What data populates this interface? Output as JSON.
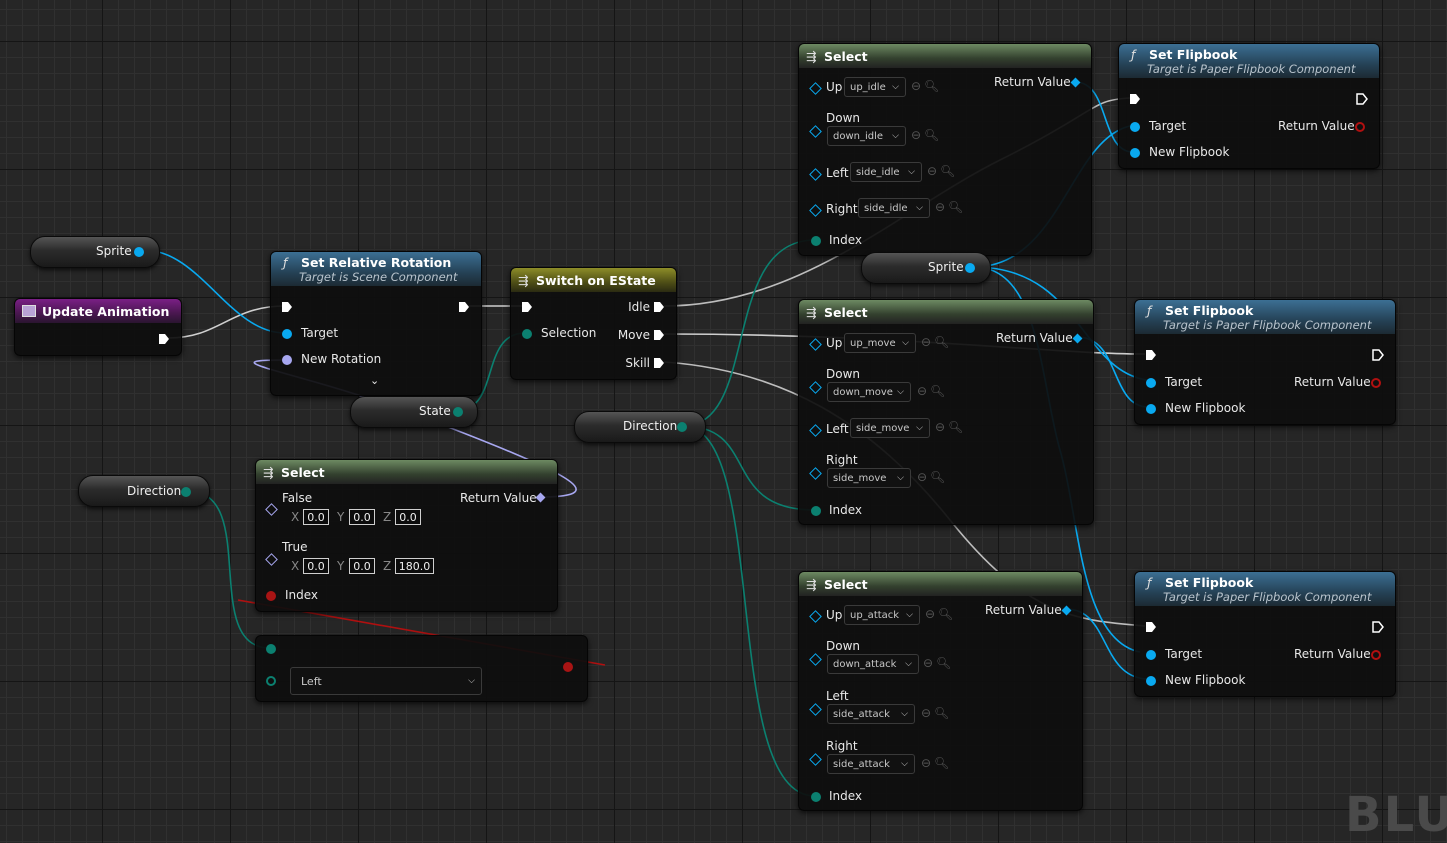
{
  "graph": {
    "watermark": "BLU"
  },
  "event_update": {
    "title": "Update Animation"
  },
  "var_sprite_a": {
    "label": "Sprite"
  },
  "var_sprite_b": {
    "label": "Sprite"
  },
  "var_state": {
    "label": "State"
  },
  "var_direction_a": {
    "label": "Direction"
  },
  "var_direction_b": {
    "label": "Direction"
  },
  "set_rotation": {
    "title": "Set Relative Rotation",
    "subtitle": "Target is Scene Component",
    "pins": [
      "Target",
      "New Rotation"
    ]
  },
  "switch": {
    "title": "Switch on EState",
    "in_pin": "Selection",
    "outputs": [
      "Idle",
      "Move",
      "Skill"
    ]
  },
  "select_rot": {
    "title": "Select",
    "false_label": "False",
    "true_label": "True",
    "return_label": "Return Value",
    "index_label": "Index",
    "axes": [
      "X",
      "Y",
      "Z"
    ],
    "false_vals": [
      "0.0",
      "0.0",
      "0.0"
    ],
    "true_vals": [
      "0.0",
      "0.0",
      "180.0"
    ]
  },
  "enum_node": {
    "value": "Left"
  },
  "select_idle": {
    "title": "Select",
    "return_label": "Return Value",
    "index_label": "Index",
    "rows": [
      {
        "label": "Up",
        "value": "up_idle"
      },
      {
        "label": "Down",
        "value": "down_idle"
      },
      {
        "label": "Left",
        "value": "side_idle"
      },
      {
        "label": "Right",
        "value": "side_idle"
      }
    ]
  },
  "select_move": {
    "title": "Select",
    "return_label": "Return Value",
    "index_label": "Index",
    "rows": [
      {
        "label": "Up",
        "value": "up_move"
      },
      {
        "label": "Down",
        "value": "down_move"
      },
      {
        "label": "Left",
        "value": "side_move"
      },
      {
        "label": "Right",
        "value": "side_move"
      }
    ]
  },
  "select_attack": {
    "title": "Select",
    "return_label": "Return Value",
    "index_label": "Index",
    "rows": [
      {
        "label": "Up",
        "value": "up_attack"
      },
      {
        "label": "Down",
        "value": "down_attack"
      },
      {
        "label": "Left",
        "value": "side_attack"
      },
      {
        "label": "Right",
        "value": "side_attack"
      }
    ]
  },
  "flipbook_1": {
    "title": "Set Flipbook",
    "subtitle": "Target is Paper Flipbook Component",
    "target": "Target",
    "new_flipbook": "New Flipbook",
    "return_label": "Return Value"
  },
  "flipbook_2": {
    "title": "Set Flipbook",
    "subtitle": "Target is Paper Flipbook Component",
    "target": "Target",
    "new_flipbook": "New Flipbook",
    "return_label": "Return Value"
  },
  "flipbook_3": {
    "title": "Set Flipbook",
    "subtitle": "Target is Paper Flipbook Component",
    "target": "Target",
    "new_flipbook": "New Flipbook",
    "return_label": "Return Value"
  },
  "colors": {
    "exec_wire": "#d8d8d8",
    "object_pin": "#09a9f0",
    "enum_pin": "#0b8070",
    "rotator_pin": "#a7a7f0",
    "bool_pin": "#a81414"
  }
}
